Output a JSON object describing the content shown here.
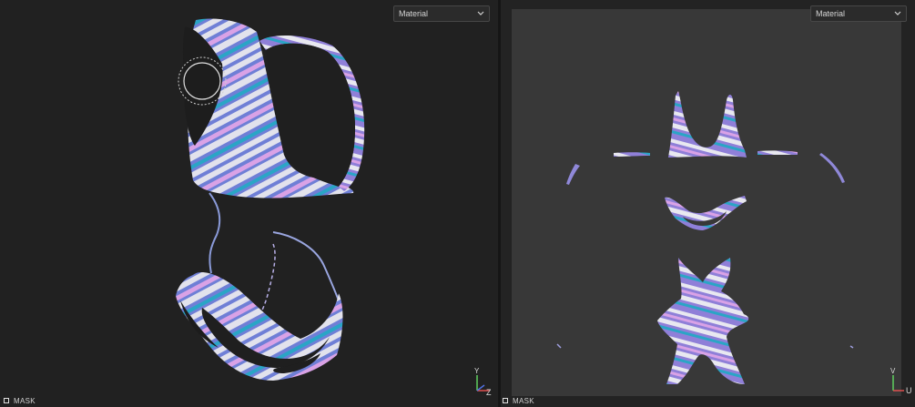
{
  "viewport_3d": {
    "dropdown_value": "Material",
    "mask_label": "MASK",
    "gizmo": {
      "axis_y": "Y",
      "axis_z": "Z"
    }
  },
  "viewport_2d": {
    "dropdown_value": "Material",
    "mask_label": "MASK",
    "gizmo": {
      "axis_v": "V",
      "axis_u": "U"
    }
  },
  "colors": {
    "viewport_bg": "#212121",
    "uv_bg": "#383838",
    "pattern_blue": "#6f7fd6",
    "pattern_purple": "#8f7fd8",
    "pattern_pink": "#d9a2e6",
    "pattern_cyan": "#2aa5c6",
    "pattern_white": "#e2e2ec",
    "axis_green": "#5fcf5f",
    "axis_red": "#e05050",
    "axis_blue": "#5070e0"
  }
}
